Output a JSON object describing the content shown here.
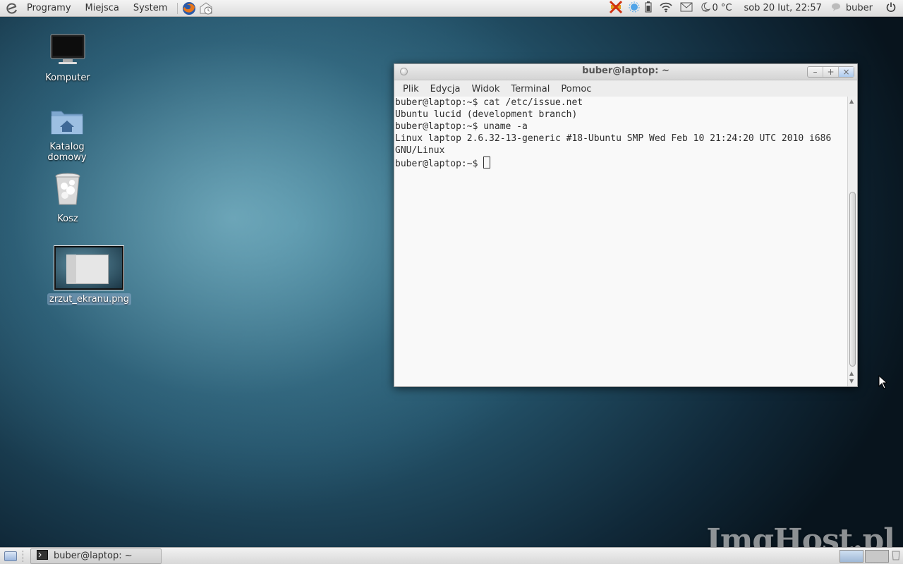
{
  "top_panel": {
    "menus": [
      "Programy",
      "Miejsca",
      "System"
    ],
    "launchers": [
      "firefox-icon",
      "mail-clock-icon"
    ],
    "weather": "0 °C",
    "clock": "sob 20 lut, 22:57",
    "user": "buber"
  },
  "desktop": {
    "icons": [
      {
        "label": "Komputer",
        "icon": "computer-icon"
      },
      {
        "label": "Katalog domowy",
        "icon": "home-folder-icon"
      },
      {
        "label": "Kosz",
        "icon": "trash-icon"
      },
      {
        "label": "zrzut_ekranu.png",
        "icon": "image-thumbnail-icon"
      }
    ]
  },
  "terminal": {
    "title": "buber@laptop: ~",
    "menu": [
      "Plik",
      "Edycja",
      "Widok",
      "Terminal",
      "Pomoc"
    ],
    "lines": [
      "buber@laptop:~$ cat /etc/issue.net",
      "Ubuntu lucid (development branch)",
      "buber@laptop:~$ uname -a",
      "Linux laptop 2.6.32-13-generic #18-Ubuntu SMP Wed Feb 10 21:24:20 UTC 2010 i686",
      "GNU/Linux",
      "buber@laptop:~$ "
    ]
  },
  "bottom_panel": {
    "task": "buber@laptop: ~"
  },
  "watermark": "ImgHost.pl"
}
